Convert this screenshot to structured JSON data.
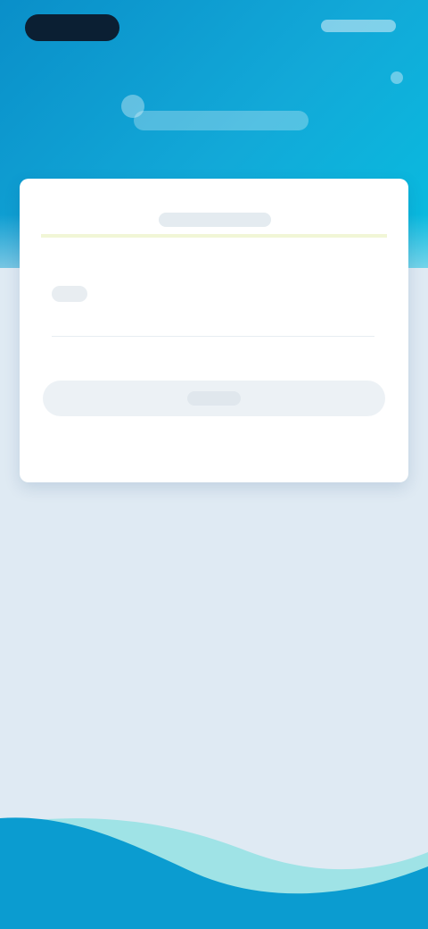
{
  "colors": {
    "header_start": "#0a8fc9",
    "header_end": "#08bde0",
    "page_background": "#dfeaf3",
    "card_background": "#ffffff",
    "status_pill": "#0b1f33",
    "wave_primary": "#0b9cd0",
    "wave_secondary": "#9fe3e6"
  }
}
